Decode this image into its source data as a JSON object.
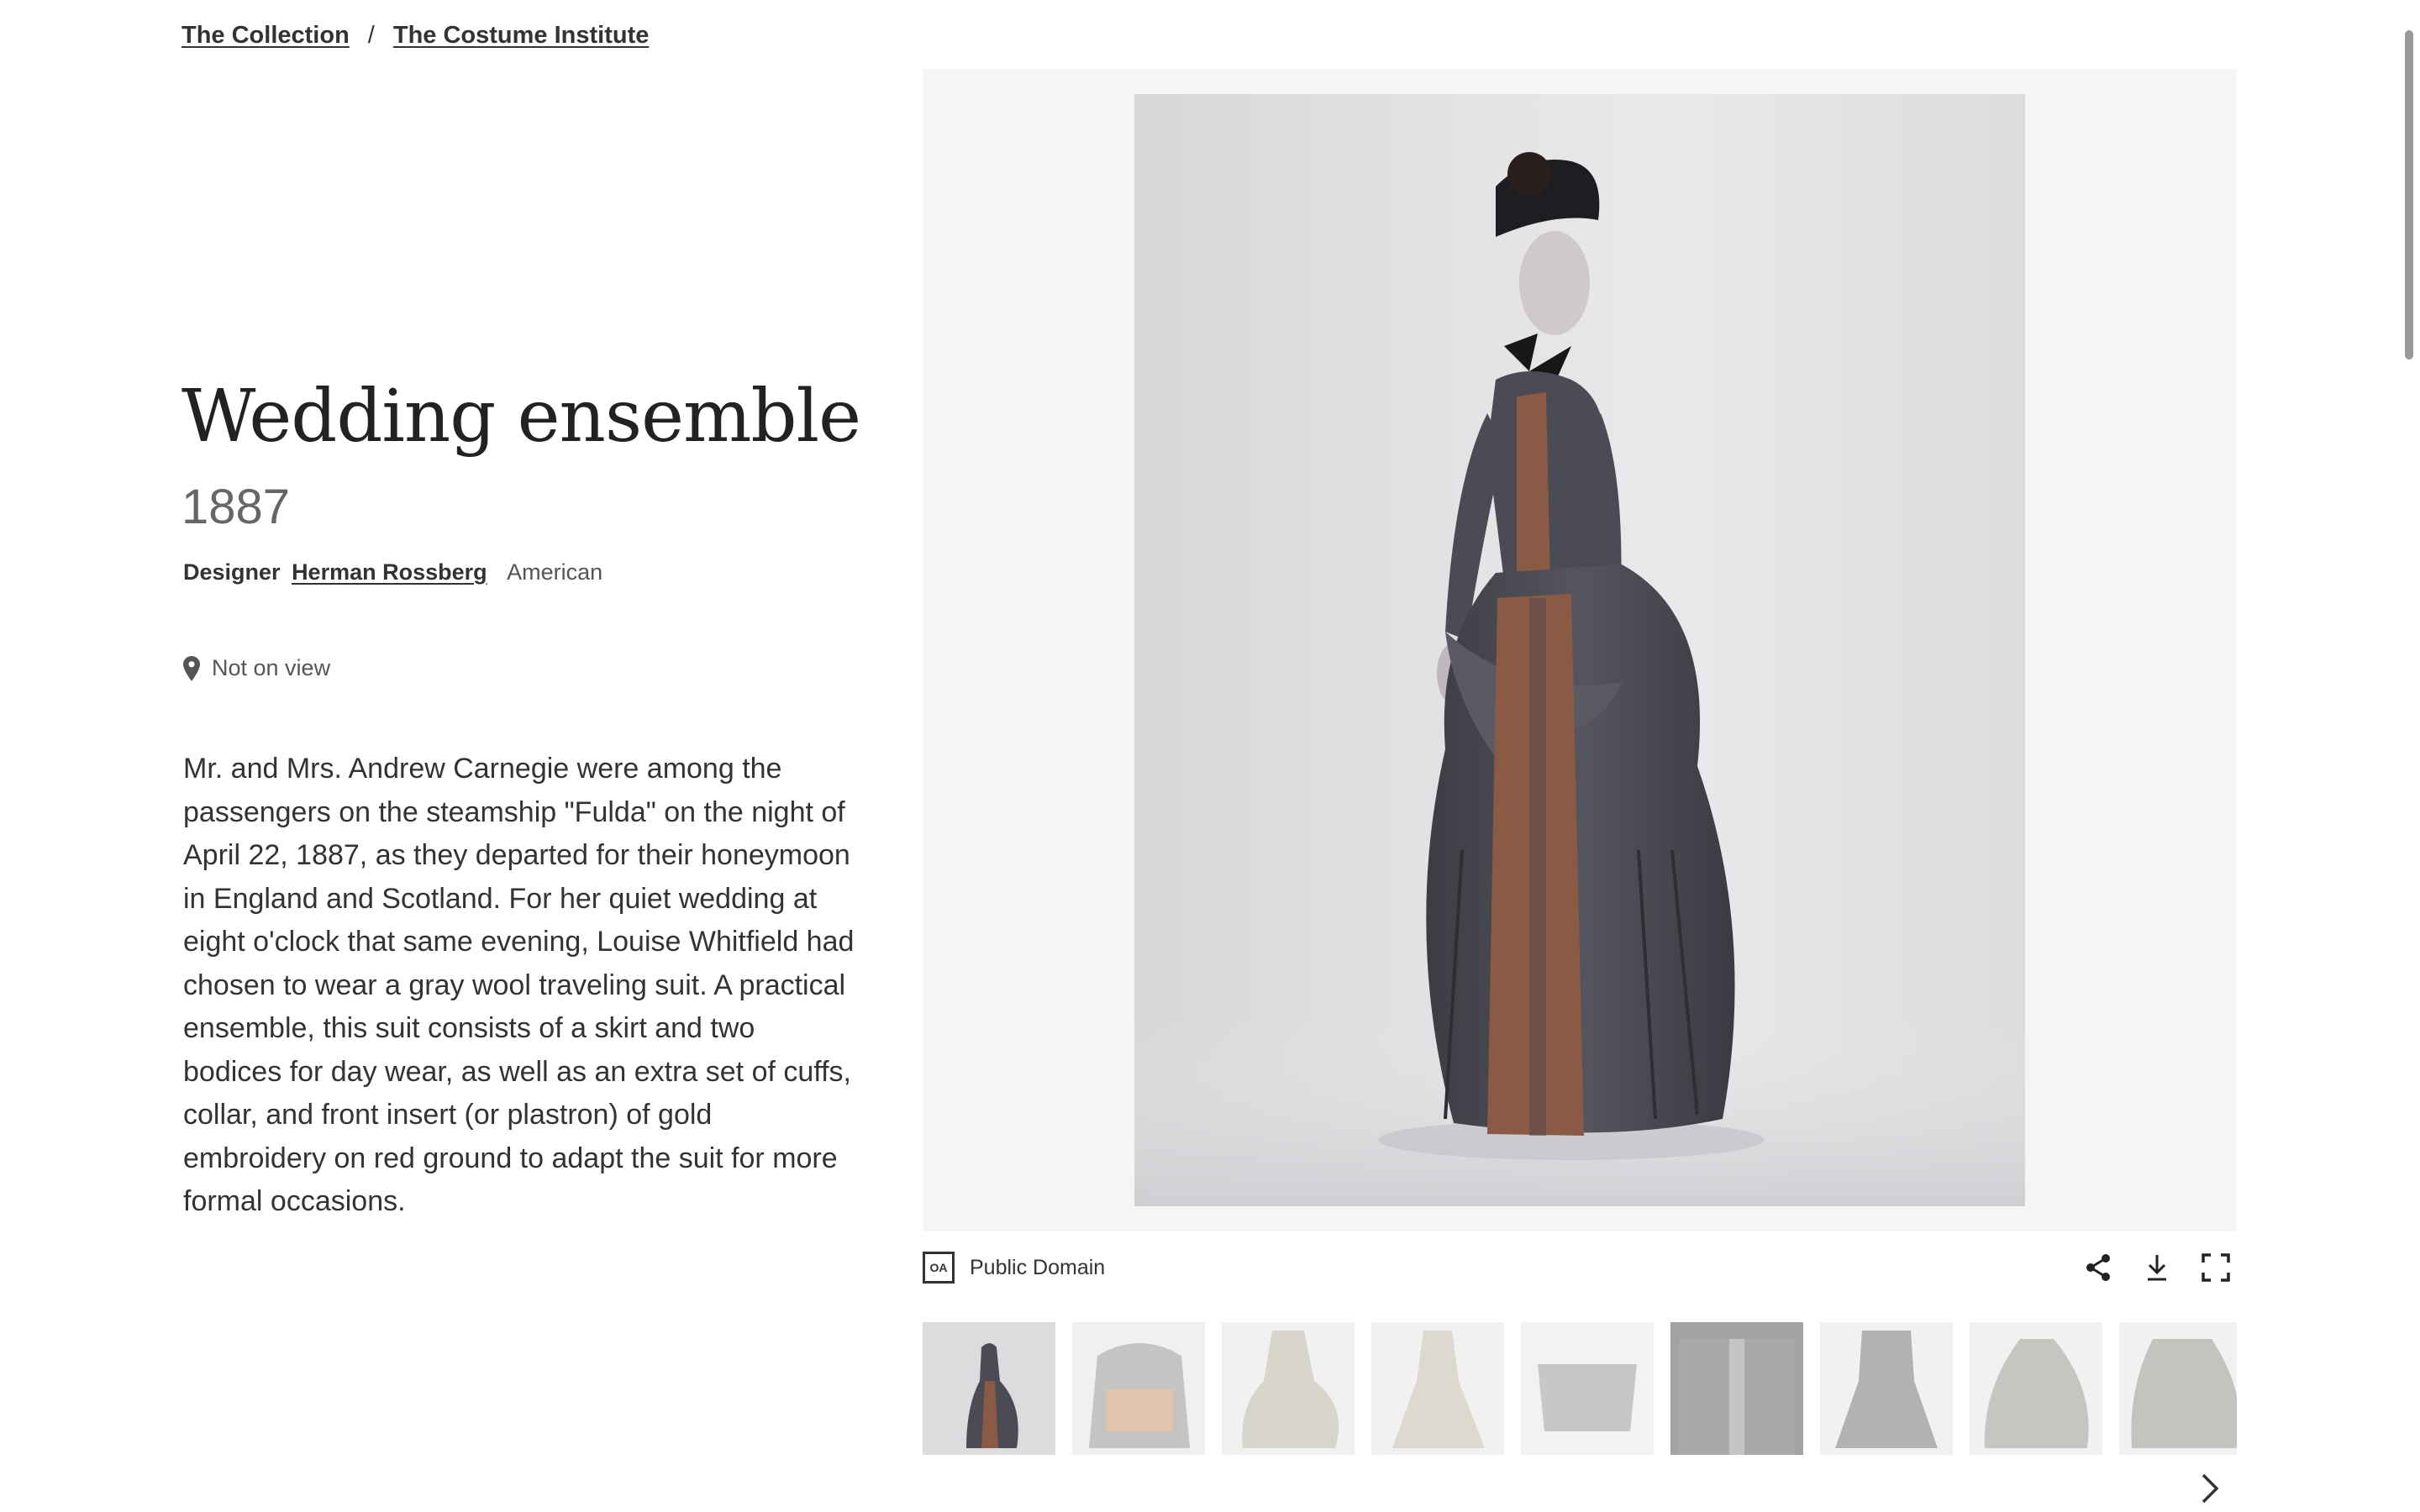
{
  "breadcrumb": {
    "items": [
      "The Collection",
      "The Costume Institute"
    ],
    "separator": "/"
  },
  "artwork": {
    "title": "Wedding ensemble",
    "date": "1887",
    "maker_role": "Designer",
    "maker_name": "Herman Rossberg",
    "maker_nationality": "American",
    "location_status": "Not on view",
    "description": "Mr. and Mrs. Andrew Carnegie were among the passengers on the steamship \"Fulda\" on the night of April 22, 1887, as they departed for their honeymoon in England and Scotland. For her quiet wedding at eight o'clock that same evening, Louise Whitfield had chosen to wear a gray wool traveling suit. A practical ensemble, this suit consists of a skirt and two bodices for day wear, as well as an extra set of cuffs, collar, and front insert (or plastron) of gold embroidery on red ground to adapt the suit for more formal occasions."
  },
  "image": {
    "rights_badge": "OA",
    "rights_label": "Public Domain",
    "tools": [
      "share-icon",
      "download-icon",
      "fullscreen-icon"
    ]
  },
  "thumbnails": {
    "count_visible": 9,
    "selected_index": 0
  },
  "colors": {
    "text": "#222222",
    "muted": "#666666",
    "panel_bg": "#f5f5f5",
    "dress_gray": "#4a4a52",
    "embroidery": "#8a5a44"
  }
}
